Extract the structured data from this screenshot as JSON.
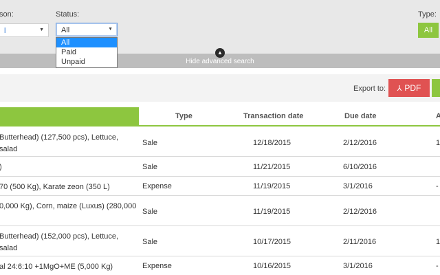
{
  "filters": {
    "season_label": "son:",
    "season_value": "l",
    "status_label": "Status:",
    "status_value": "All",
    "status_options": [
      "All",
      "Paid",
      "Unpaid"
    ],
    "type_label": "Type:",
    "type_button": "All",
    "hide_advanced_search": "Hide advanced search"
  },
  "export": {
    "label": "Export to:",
    "pdf_label": "PDF"
  },
  "table": {
    "headers": [
      "Type",
      "Transaction date",
      "Due date",
      "A"
    ],
    "rows": [
      {
        "desc1": "Butterhead) (127,500 pcs), Lettuce, salad",
        "desc2": "",
        "type": "Sale",
        "tdate": "12/18/2015",
        "ddate": "2/12/2016",
        "amount": "1"
      },
      {
        "desc1": ")",
        "desc2": "",
        "type": "Sale",
        "tdate": "11/21/2015",
        "ddate": "6/10/2016",
        "amount": ""
      },
      {
        "desc1": "70 (500 Kg), Karate zeon (350 L)",
        "desc2": "",
        "type": "Expense",
        "tdate": "11/19/2015",
        "ddate": "3/1/2016",
        "amount": "-"
      },
      {
        "desc1": "0,000 Kg), Corn, maize (Luxus) (280,000",
        "desc2": "",
        "type": "Sale",
        "tdate": "11/19/2015",
        "ddate": "2/12/2016",
        "amount": ""
      },
      {
        "desc1": "Butterhead) (152,000 pcs), Lettuce, salad",
        "desc2": "",
        "type": "Sale",
        "tdate": "10/17/2015",
        "ddate": "2/11/2016",
        "amount": "1"
      },
      {
        "desc1": "al 24:6:10 +1MgO+ME (5,000 Kg)",
        "desc2": "",
        "type": "Expense",
        "tdate": "10/16/2015",
        "ddate": "3/1/2016",
        "amount": "-"
      }
    ]
  },
  "colors": {
    "accent_green": "#8dc63f",
    "pdf_red": "#e05252",
    "selection_blue": "#1e90ff"
  }
}
